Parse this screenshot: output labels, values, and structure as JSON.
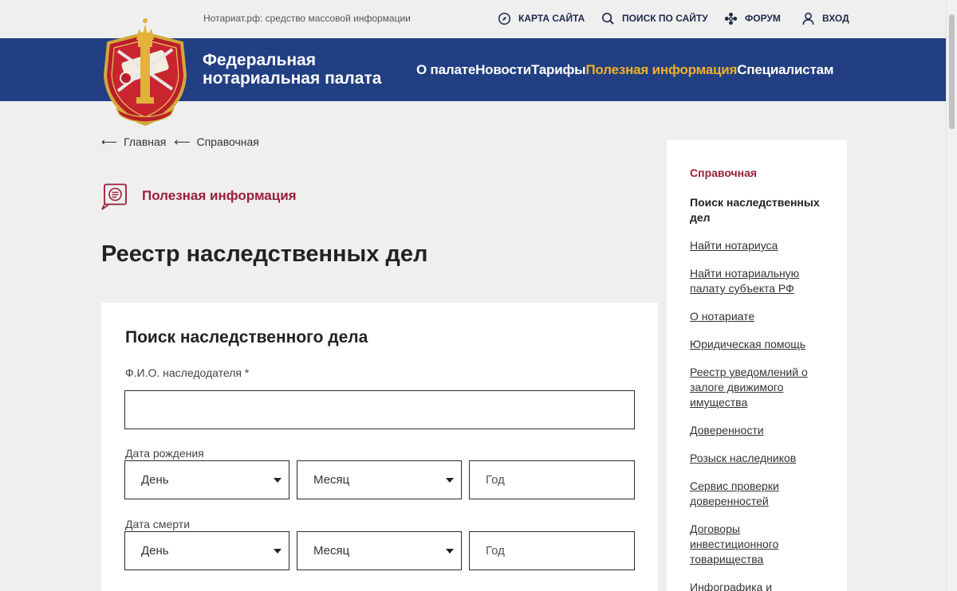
{
  "topbar": {
    "tagline": "Нотариат.рф: средство массовой информации",
    "links": [
      {
        "label": "КАРТА САЙТА",
        "icon": "compass-icon"
      },
      {
        "label": "ПОИСК ПО САЙТУ",
        "icon": "search-icon"
      },
      {
        "label": "ФОРУМ",
        "icon": "forum-icon"
      },
      {
        "label": "ВХОД",
        "icon": "user-icon"
      }
    ]
  },
  "header": {
    "brand_line1": "Федеральная",
    "brand_line2": "нотариальная палата",
    "nav": [
      {
        "label": "О палате",
        "active": false
      },
      {
        "label": "Новости",
        "active": false
      },
      {
        "label": "Тарифы",
        "active": false
      },
      {
        "label": "Полезная информация",
        "active": true
      },
      {
        "label": "Специалистам",
        "active": false
      }
    ],
    "colors": {
      "bar": "#213f82",
      "active": "#f2b02c"
    }
  },
  "breadcrumb": [
    {
      "label": "Главная"
    },
    {
      "label": "Справочная"
    }
  ],
  "section": {
    "label": "Полезная информация",
    "icon": "chat-document-icon"
  },
  "page_title": "Реестр наследственных дел",
  "form": {
    "title": "Поиск наследственного дела",
    "fio_label": "Ф.И.О. наследодателя *",
    "fio_value": "",
    "birth_label": "Дата рождения",
    "death_label": "Дата смерти",
    "day": "День",
    "month": "Месяц",
    "year_placeholder": "Год"
  },
  "sidebar": {
    "heading": "Справочная",
    "items": [
      {
        "label": "Поиск наследственных дел",
        "current": true
      },
      {
        "label": "Найти нотариуса"
      },
      {
        "label": "Найти нотариальную палату субъекта РФ"
      },
      {
        "label": "О нотариате"
      },
      {
        "label": "Юридическая помощь"
      },
      {
        "label": "Реестр уведомлений о залоге движимого имущества"
      },
      {
        "label": "Доверенности"
      },
      {
        "label": "Розыск наследников"
      },
      {
        "label": "Сервис проверки доверенностей"
      },
      {
        "label": "Договоры инвестиционного товарищества"
      },
      {
        "label": "Инфографика и"
      }
    ]
  },
  "colors": {
    "accent": "#9a1f3a",
    "page_bg": "#efefef"
  }
}
